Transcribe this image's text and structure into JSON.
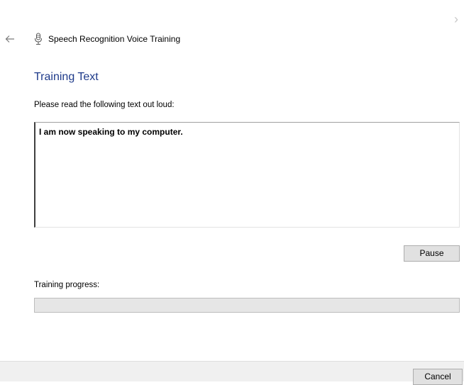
{
  "window": {
    "title": "Speech Recognition Voice Training",
    "back_icon": "back-arrow-icon",
    "next_icon": "next-arrow-icon",
    "title_icon": "microphone-icon"
  },
  "main": {
    "heading": "Training Text",
    "instruction": "Please read the following text out loud:",
    "training_text": "I am now speaking to my computer.",
    "pause_label": "Pause",
    "progress_label": "Training progress:",
    "progress_percent": 0
  },
  "footer": {
    "cancel_label": "Cancel"
  },
  "colors": {
    "heading": "#1e3a8a",
    "button_face": "#e1e1e1",
    "progress_track": "#e6e6e6",
    "progress_fill": "#06b025"
  }
}
